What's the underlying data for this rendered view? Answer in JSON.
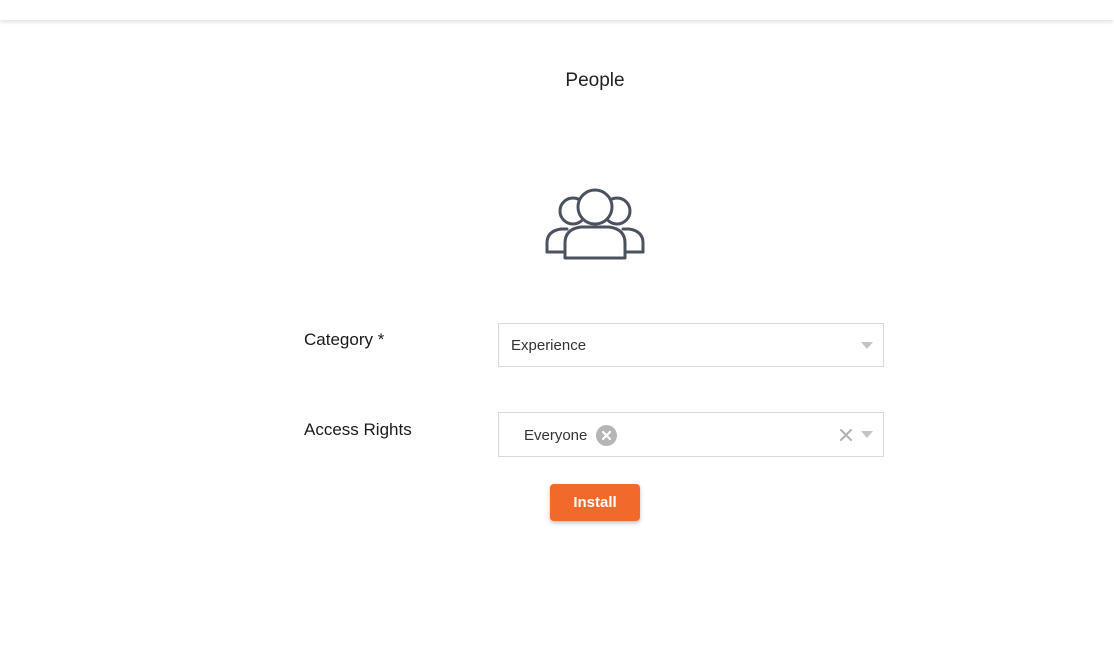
{
  "header": {
    "title": "People"
  },
  "hero": {
    "icon": "people-group-icon"
  },
  "form": {
    "category": {
      "label": "Category *",
      "value": "Experience",
      "icon": "chevron-down-icon"
    },
    "access_rights": {
      "label": "Access Rights",
      "tags": [
        "Everyone"
      ],
      "remove_icon": "close-circle-icon",
      "clear_icon": "close-icon",
      "dropdown_icon": "chevron-down-icon"
    },
    "install_label": "Install"
  },
  "colors": {
    "accent": "#f26a2b",
    "icon_stroke": "#4a5260",
    "border": "#d9d9d9",
    "tag_remove": "#b5b5b5"
  }
}
